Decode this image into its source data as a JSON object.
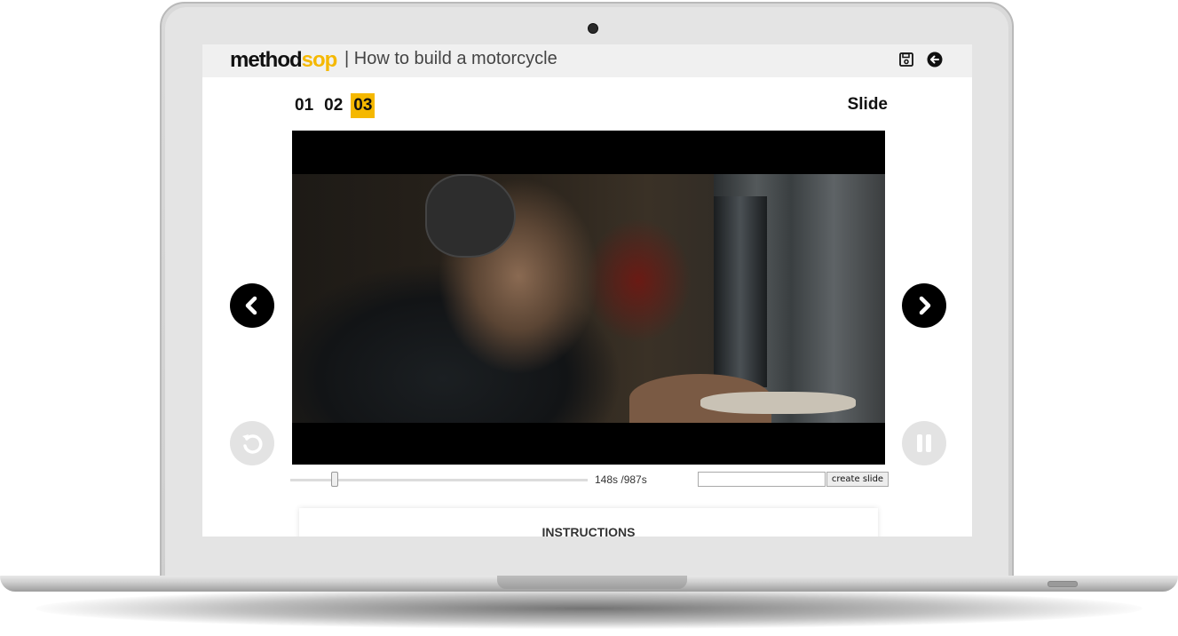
{
  "app": {
    "logo_main": "method",
    "logo_accent": "sop",
    "title": "| How to build a motorcycle"
  },
  "header_icons": [
    "save-icon",
    "back-arrow-icon"
  ],
  "steps": [
    {
      "label": "01",
      "active": false
    },
    {
      "label": "02",
      "active": false
    },
    {
      "label": "03",
      "active": true
    }
  ],
  "slide_label": "Slide",
  "player": {
    "time_display": "148s /987s",
    "progress_fraction": 0.15,
    "slide_input_value": "",
    "create_slide_label": "create slide"
  },
  "instructions": {
    "title": "INSTRUCTIONS"
  },
  "colors": {
    "accent": "#f5b800",
    "header_bg": "#f0f0f0"
  }
}
